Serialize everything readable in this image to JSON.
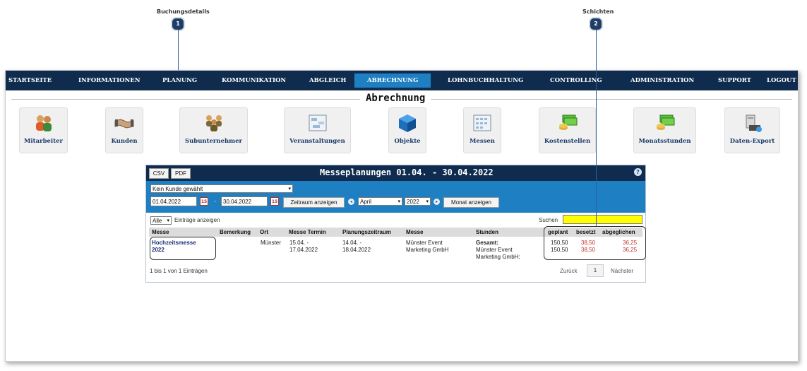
{
  "callouts": [
    {
      "label": "Buchungsdetails",
      "number": "1"
    },
    {
      "label": "Schichten",
      "number": "2"
    }
  ],
  "nav": {
    "items": [
      "STARTSEITE",
      "INFORMATIONEN",
      "PLANUNG",
      "KOMMUNIKATION",
      "ABGLEICH",
      "ABRECHNUNG",
      "LOHNBUCHHALTUNG",
      "CONTROLLING",
      "ADMINISTRATION",
      "SUPPORT",
      "LOGOUT"
    ],
    "active": "ABRECHNUNG"
  },
  "section_title": "Abrechnung",
  "tiles": [
    {
      "label": "Mitarbeiter",
      "icon": "users-icon"
    },
    {
      "label": "Kunden",
      "icon": "handshake-icon"
    },
    {
      "label": "Subunternehmer",
      "icon": "group-icon"
    },
    {
      "label": "Veranstaltungen",
      "icon": "calendar-board-icon"
    },
    {
      "label": "Objekte",
      "icon": "cube-icon"
    },
    {
      "label": "Messen",
      "icon": "grid-board-icon"
    },
    {
      "label": "Kostenstellen",
      "icon": "money-icon"
    },
    {
      "label": "Monatsstunden",
      "icon": "money-icon"
    },
    {
      "label": "Daten-Export",
      "icon": "export-icon"
    }
  ],
  "panel": {
    "title": "Messeplanungen 01.04. - 30.04.2022",
    "csv": "CSV",
    "pdf": "PDF",
    "customer_select": "Kein Kunde gewählt",
    "date_from": "01.04.2022",
    "date_sep": "-",
    "date_to": "30.04.2022",
    "range_button": "Zeitraum anzeigen",
    "month": "April",
    "year": "2022",
    "month_button": "Monat anzeigen",
    "entries_select": "Alle",
    "entries_label": "Einträge anzeigen",
    "search_label": "Suchen",
    "search_value": "",
    "columns": [
      "Messe",
      "Bemerkung",
      "Ort",
      "Messe Termin",
      "Planungszeitraum",
      "Messe",
      "Stunden",
      "geplant",
      "besetzt",
      "abgeglichen"
    ],
    "row": {
      "messe": "Hochzeitsmesse 2022",
      "bemerkung": "",
      "ort": "Münster",
      "termin": "15.04. - 17.04.2022",
      "planung": "14.04. - 18.04.2022",
      "messe2": "Münster Event Marketing GmbH",
      "stunden_total": "Gesamt:",
      "stunden_firma": "Münster Event Marketing GmbH:",
      "geplant": [
        "150,50",
        "150,50"
      ],
      "besetzt": [
        "38,50",
        "38,50"
      ],
      "abgeglichen": [
        "36,25",
        "36,25"
      ]
    },
    "info": "1 bis 1 von 1 Einträgen",
    "prev": "Zurück",
    "page": "1",
    "next": "Nächster"
  },
  "colors": {
    "nav_bg": "#0f2c4f",
    "accent": "#1f7fc3",
    "search_bg": "#ffff00",
    "values_red": "#c0302a"
  }
}
